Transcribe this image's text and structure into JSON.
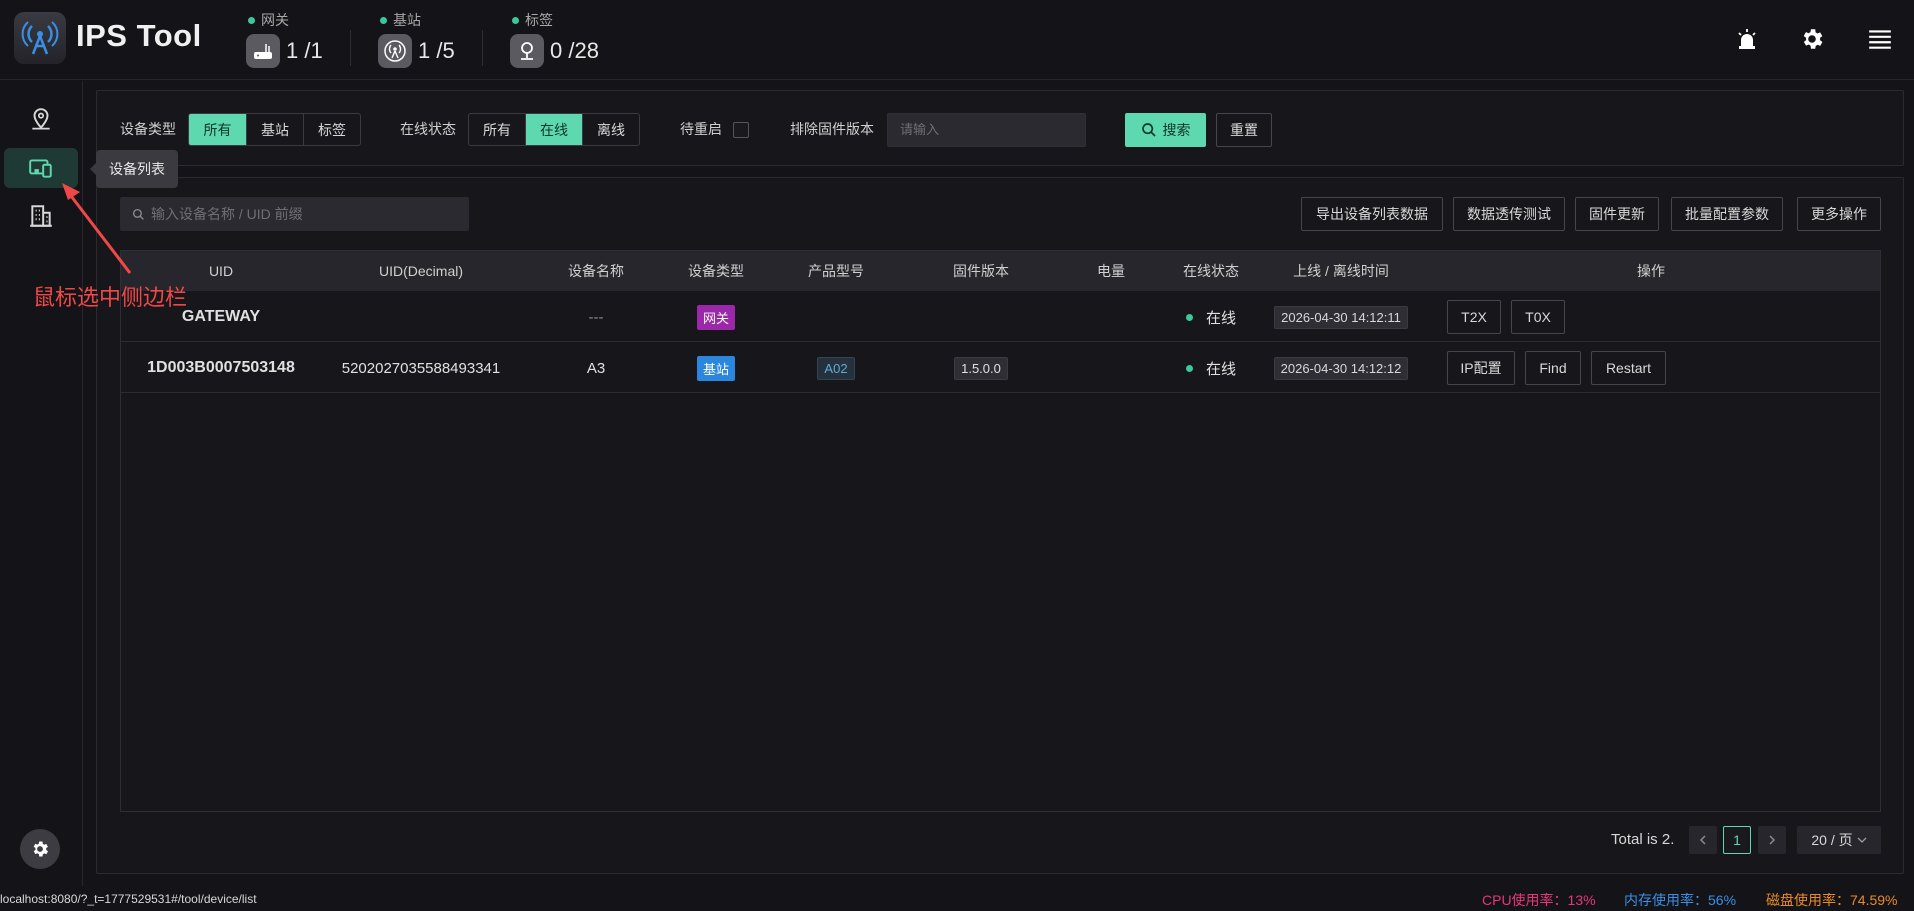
{
  "app": {
    "title": "IPS Tool"
  },
  "stats": [
    {
      "label": "网关",
      "value": "1 /1",
      "icon": "router-icon"
    },
    {
      "label": "基站",
      "value": "1 /5",
      "icon": "antenna-icon"
    },
    {
      "label": "标签",
      "value": "0 /28",
      "icon": "location-tag-icon"
    }
  ],
  "filters": {
    "device_type_label": "设备类型",
    "device_type_options": [
      "所有",
      "基站",
      "标签"
    ],
    "device_type_selected": "所有",
    "online_label": "在线状态",
    "online_options": [
      "所有",
      "在线",
      "离线"
    ],
    "online_selected": "在线",
    "pending_restart_label": "待重启",
    "exclude_fw_label": "排除固件版本",
    "exclude_fw_placeholder": "请输入",
    "search_label": "搜索",
    "reset_label": "重置"
  },
  "sidebar": {
    "tooltip": "设备列表"
  },
  "toolbar": {
    "search_placeholder": "输入设备名称 / UID 前缀",
    "actions": [
      "导出设备列表数据",
      "数据透传测试",
      "固件更新",
      "批量配置参数",
      "更多操作"
    ]
  },
  "table": {
    "columns": [
      "UID",
      "UID(Decimal)",
      "设备名称",
      "设备类型",
      "产品型号",
      "固件版本",
      "电量",
      "在线状态",
      "上线 / 离线时间",
      "操作"
    ],
    "rows": [
      {
        "uid": "GATEWAY",
        "uid_decimal": "",
        "name": "---",
        "type": "网关",
        "model": "",
        "firmware": "",
        "battery": "",
        "status": "在线",
        "time": "2026-04-30 14:12:11",
        "ops": [
          "T2X",
          "T0X"
        ]
      },
      {
        "uid": "1D003B0007503148",
        "uid_decimal": "5202027035588493341",
        "name": "A3",
        "type": "基站",
        "model": "A02",
        "firmware": "1.5.0.0",
        "battery": "",
        "status": "在线",
        "time": "2026-04-30 14:12:12",
        "ops": [
          "IP配置",
          "Find",
          "Restart"
        ]
      }
    ]
  },
  "pagination": {
    "total": "Total is 2.",
    "current": "1",
    "page_size": "20 / 页"
  },
  "status_bar": {
    "url": "localhost:8080/?_t=1777529531#/tool/device/list",
    "cpu": "CPU使用率：13%",
    "mem": "内存使用率：56%",
    "disk": "磁盘使用率：74.59%"
  },
  "annotation": "鼠标选中侧边栏",
  "colors": {
    "accent": "#5ed8ae",
    "cpu": "#e8367a",
    "mem": "#3a8ee6",
    "disk": "#e88a2a",
    "annotation": "#f04848"
  }
}
